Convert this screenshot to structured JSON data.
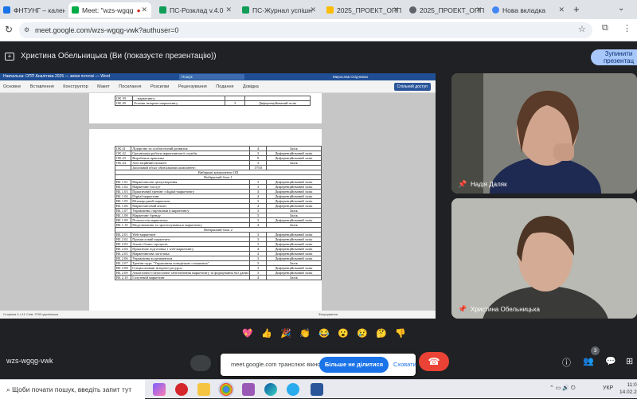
{
  "browser": {
    "tabs": [
      {
        "label": "ФНТУНГ – календар"
      },
      {
        "label": "Meet: \"wzs-wgqg"
      },
      {
        "label": "ПС-Розклад v.4.0"
      },
      {
        "label": "ПС-Журнал успішн"
      },
      {
        "label": "2025_ПРОЕКТ_ОПП"
      },
      {
        "label": "2025_ПРОЕКТ_ОПП"
      },
      {
        "label": "Нова вкладка"
      }
    ],
    "url": "meet.google.com/wzs-wgqg-vwk?authuser=0"
  },
  "meet": {
    "presenter_text": "Христина Обельницька (Ви (показуєте презентацію))",
    "stop_button": "Зупинити презентац",
    "participants": [
      {
        "name": "Надія Даляк"
      },
      {
        "name": "Христина Обельницька"
      }
    ],
    "reactions": [
      "💖",
      "👍",
      "🎉",
      "👏",
      "😂",
      "😮",
      "😢",
      "🤔",
      "👎"
    ],
    "meeting_code": "wzs-wgqg-vwk",
    "participant_count": "3",
    "toast": {
      "message": "meet.google.com транслює вікно.",
      "stop_share": "Більше не ділитися",
      "hide": "Сховати"
    }
  },
  "word": {
    "title": "Навчальна: ОПП Аналітика 2025 — зміни поточні — Word",
    "search": "Пошук",
    "user": "Мирослав Осідчемко",
    "ribbon_tabs": [
      "Основне",
      "Вставлення",
      "Конструктор",
      "Макет",
      "Посилання",
      "Розсилки",
      "Рецензування",
      "Подання",
      "Довідка"
    ],
    "share": "Спільний доступ",
    "status_left": "Сторінка 4 з 11   Слів: 3700   українська",
    "status_right": "Фокусування",
    "page1_rows": [
      [
        "ОК 39",
        "…маркетингу",
        "",
        ""
      ],
      [
        "ОК 40",
        "Основи інтернет-маркетингу",
        "3",
        "Диференційований залік"
      ]
    ],
    "page2_rows": [
      [
        "ОК 41",
        "Лідерство та особистісний розвиток",
        "4",
        "Залік"
      ],
      [
        "ОК 42",
        "Організація роботи маркетингової служби",
        "3",
        "Диференційований залік"
      ],
      [
        "ОК 43",
        "Виробнича практика",
        "9",
        "Диференційований залік"
      ],
      [
        "ОК 44",
        "Атестаційний екзамен",
        "3",
        "Залік"
      ],
      [
        "",
        "Загальний обсяг обов'язкових компонент:",
        "179,0",
        ""
      ],
      [
        "",
        "Вибіркові компоненти ОП",
        "",
        ""
      ],
      [
        "",
        "Вибірковий блок 1",
        "",
        ""
      ],
      [
        "ВБ 1.01",
        "Маркетингове ціноутворення",
        "3",
        "Диференційований залік"
      ],
      [
        "ВБ 1.02",
        "Маркетинг послуг",
        "3",
        "Диференційований залік"
      ],
      [
        "ВБ 1.03",
        "Практичний тренінг з digital-маркетингу",
        "4",
        "Диференційований залік"
      ],
      [
        "ВБ 1.04",
        "Digital-маркетинг",
        "4",
        "Диференційований залік"
      ],
      [
        "ВБ 1.05",
        "Міжнародний маркетинг",
        "3",
        "Диференційований залік"
      ],
      [
        "ВБ 1.06",
        "Маркетинговий аналіз",
        "4",
        "Диференційований залік"
      ],
      [
        "ВБ 1.07",
        "Управління стартапами в маркетингу",
        "3",
        "Залік"
      ],
      [
        "ВБ 1.08",
        "Маркетинг бренду",
        "3",
        "Залік"
      ],
      [
        "ВБ 1.09",
        "Психологія маркетингу",
        "3",
        "Диференційований залік"
      ],
      [
        "ВБ 1.10",
        "Моделювання та прогнозування в маркетингу",
        "4",
        "Залік"
      ],
      [
        "",
        "Вибірковий блок 2",
        "",
        ""
      ],
      [
        "ВБ 2.01",
        "Web-маркетинг",
        "3",
        "Диференційований залік"
      ],
      [
        "ВБ 2.02",
        "Промисловий маркетинг",
        "3",
        "Диференційований залік"
      ],
      [
        "ВБ 2.03",
        "Аналіз бізнес-процесів",
        "3",
        "Диференційований залік"
      ],
      [
        "ВБ 2.04",
        "Практичне підготовка з web-маркетингу",
        "4",
        "Диференційований залік"
      ],
      [
        "ВБ 2.05",
        "Маркетингова логістика",
        "4",
        "Диференційований залік"
      ],
      [
        "ВБ 2.06",
        "Управління асортиментом",
        "3",
        "Диференційований залік"
      ],
      [
        "ВБ 2.07",
        "Тренінг-курс \"Управління поведінкою споживача\"",
        "3",
        "Залік"
      ],
      [
        "ВБ 2.08",
        "Спеціалізовані інтернет-ресурси",
        "3",
        "Диференційований залік"
      ],
      [
        "ВБ 2.09",
        "Аналітично-статистичне забезпечення маркетингу та формування баз даних",
        "3",
        "Диференційований залік"
      ],
      [
        "ВБ 2.10",
        "Галузевий маркетинг",
        "4",
        "Залік"
      ]
    ]
  },
  "taskbar": {
    "search": "Щоби почати пошук, введіть запит тут",
    "language": "УКР",
    "time": "11:0",
    "date": "14.02.2"
  }
}
